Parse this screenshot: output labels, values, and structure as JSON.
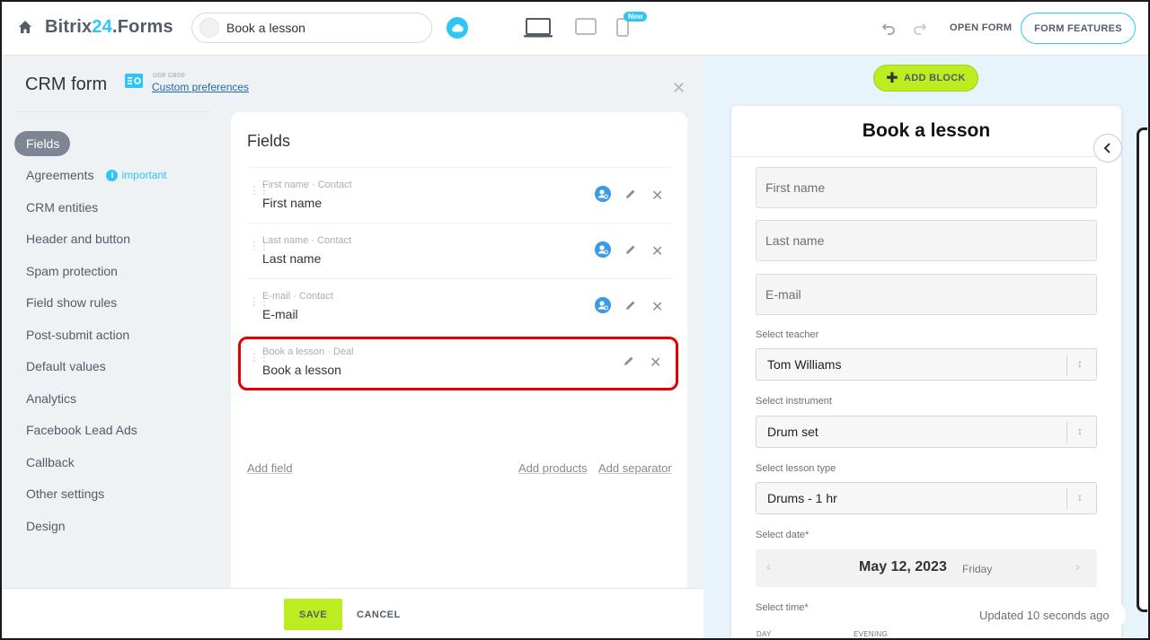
{
  "topbar": {
    "logo_main": "Bitrix",
    "logo_accent": "24",
    "logo_suffix": ".Forms",
    "form_title_value": "Book a lesson",
    "new_badge": "New",
    "open_form": "OPEN FORM",
    "form_features": "FORM FEATURES",
    "icons": [
      "home-icon",
      "cloud-icon",
      "laptop-icon",
      "tablet-icon",
      "phone-icon",
      "undo-icon",
      "redo-icon"
    ]
  },
  "settings": {
    "title": "CRM form",
    "use_case_label": "use case",
    "use_case_value": "Custom preferences",
    "sidebar": [
      {
        "label": "Fields",
        "active": true
      },
      {
        "label": "Agreements",
        "badge": "important"
      },
      {
        "label": "CRM entities"
      },
      {
        "label": "Header and button"
      },
      {
        "label": "Spam protection"
      },
      {
        "label": "Field show rules"
      },
      {
        "label": "Post-submit action"
      },
      {
        "label": "Default values"
      },
      {
        "label": "Analytics"
      },
      {
        "label": "Facebook Lead Ads"
      },
      {
        "label": "Callback"
      },
      {
        "label": "Other settings"
      },
      {
        "label": "Design"
      }
    ]
  },
  "fields_panel": {
    "title": "Fields",
    "rows": [
      {
        "sub": "First name · Contact",
        "name": "First name",
        "crm_linked": true
      },
      {
        "sub": "Last name · Contact",
        "name": "Last name",
        "crm_linked": true
      },
      {
        "sub": "E-mail · Contact",
        "name": "E-mail",
        "crm_linked": true
      },
      {
        "sub": "Book a lesson · Deal",
        "name": "Book a lesson",
        "crm_linked": false
      }
    ],
    "add_field": "Add field",
    "add_products": "Add products",
    "add_separator": "Add separator"
  },
  "bottom": {
    "save": "SAVE",
    "cancel": "CANCEL"
  },
  "preview": {
    "add_block": "ADD BLOCK",
    "form_title": "Book a lesson",
    "fields": [
      "First name",
      "Last name",
      "E-mail"
    ],
    "selects": [
      {
        "label": "Select teacher",
        "value": "Tom Williams"
      },
      {
        "label": "Select instrument",
        "value": "Drum set"
      },
      {
        "label": "Select lesson type",
        "value": "Drums - 1 hr"
      }
    ],
    "date_label": "Select date*",
    "date_value": "May 12, 2023",
    "date_weekday": "Friday",
    "time_label": "Select time*",
    "time_cols": [
      "DAY",
      "EVENING"
    ],
    "updated": "Updated 10 seconds ago"
  },
  "colors": {
    "accent": "#2fc6f6",
    "save_green": "#bbed21",
    "highlight_red": "#e30000"
  }
}
